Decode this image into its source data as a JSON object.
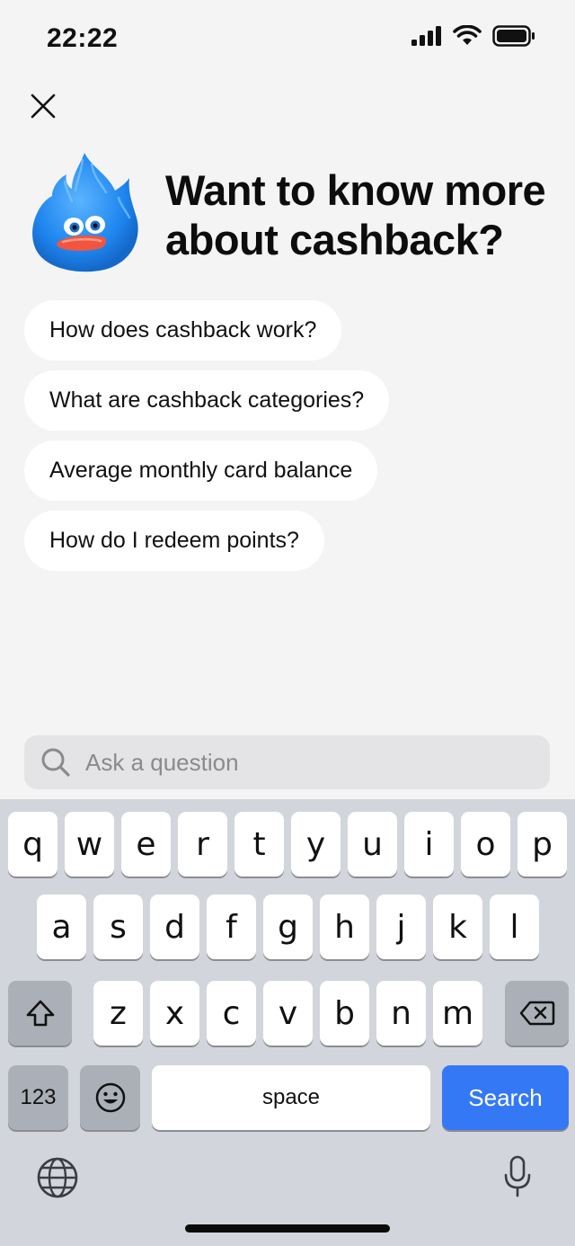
{
  "status_bar": {
    "time": "22:22"
  },
  "header": {
    "title": "Want to know more about cashback?"
  },
  "suggestions": [
    {
      "label": "How does cashback work?"
    },
    {
      "label": "What are cashback categories?"
    },
    {
      "label": "Average monthly card balance"
    },
    {
      "label": "How do I redeem points?"
    }
  ],
  "search": {
    "placeholder": "Ask a question",
    "value": ""
  },
  "keyboard": {
    "row1": [
      "q",
      "w",
      "e",
      "r",
      "t",
      "y",
      "u",
      "i",
      "o",
      "p"
    ],
    "row2": [
      "a",
      "s",
      "d",
      "f",
      "g",
      "h",
      "j",
      "k",
      "l"
    ],
    "row3": [
      "z",
      "x",
      "c",
      "v",
      "b",
      "n",
      "m"
    ],
    "numbers_label": "123",
    "space_label": "space",
    "return_label": "Search",
    "return_color": "#3478f6"
  },
  "icons": {
    "close": "close-icon",
    "search": "search-icon",
    "shift": "shift-icon",
    "backspace": "backspace-icon",
    "emoji": "emoji-icon",
    "globe": "globe-icon",
    "mic": "microphone-icon"
  }
}
